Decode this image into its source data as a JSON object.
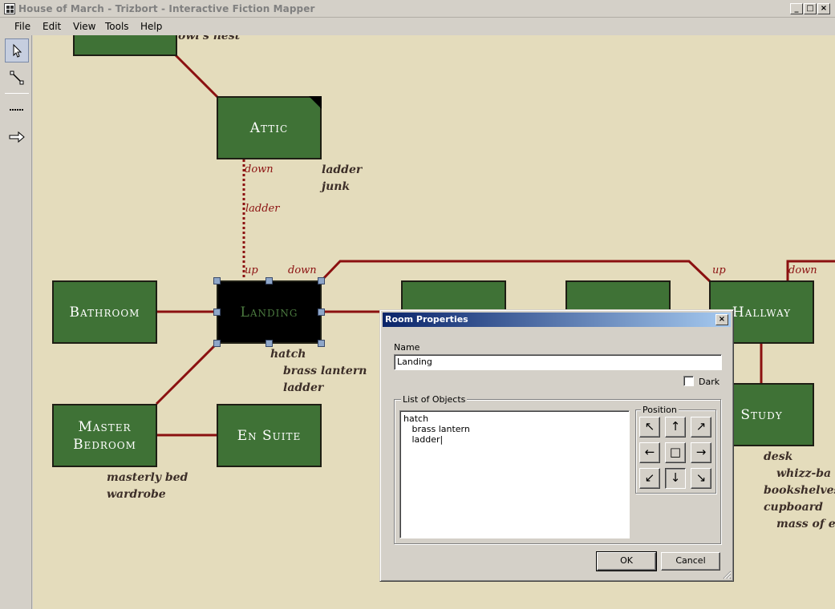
{
  "window": {
    "title": "House of March - Trizbort - Interactive Fiction Mapper",
    "controls": {
      "minimize": "_",
      "maximize": "□",
      "close": "×"
    }
  },
  "menu": [
    "File",
    "Edit",
    "View",
    "Tools",
    "Help"
  ],
  "toolbar": {
    "tools": [
      {
        "name": "select-tool",
        "icon": "pointer-icon",
        "active": true
      },
      {
        "name": "connection-tool",
        "icon": "connect-icon",
        "active": false
      },
      {
        "name": "line-tool",
        "icon": "dashed-line-icon",
        "active": false
      },
      {
        "name": "arrow-tool",
        "icon": "arrow-right-icon",
        "active": false
      }
    ]
  },
  "map": {
    "colors": {
      "canvas": "#e4dcbc",
      "room": "#3f7236",
      "connection": "#8b1010",
      "objects": "#3c2e28"
    },
    "top_partial_text": "owl's nest",
    "rooms": {
      "attic": "Attic",
      "bathroom": "Bathroom",
      "landing": "Landing",
      "master_bedroom_line1": "Master",
      "master_bedroom_line2": "Bedroom",
      "en_suite": "En Suite",
      "hallway": "Hallway",
      "study": "Study"
    },
    "objects": {
      "attic": [
        "ladder",
        "junk"
      ],
      "landing": [
        "hatch",
        "brass lantern",
        "ladder"
      ],
      "master_bedroom": [
        "masterly bed",
        "wardrobe"
      ],
      "study": [
        "desk",
        "whizz-ba",
        "bookshelves",
        "cupboard",
        "mass of el"
      ]
    },
    "connection_labels": {
      "attic_down": "down",
      "attic_ladder": "ladder",
      "landing_up": "up",
      "landing_down": "down",
      "hallway_up": "up",
      "hallway_down": "down"
    }
  },
  "dialog": {
    "title": "Room Properties",
    "close": "×",
    "name_label": "Name",
    "name_value": "Landing",
    "dark_label": "Dark",
    "dark_checked": false,
    "objects_group_label": "List of Objects",
    "objects_text": "hatch\n   brass lantern\n   ladder|",
    "position_group_label": "Position",
    "position_buttons": [
      {
        "name": "position-nw-button",
        "glyph": "↖",
        "pressed": false
      },
      {
        "name": "position-n-button",
        "glyph": "↑",
        "pressed": false
      },
      {
        "name": "position-ne-button",
        "glyph": "↗",
        "pressed": false
      },
      {
        "name": "position-w-button",
        "glyph": "←",
        "pressed": false
      },
      {
        "name": "position-center-button",
        "glyph": "□",
        "pressed": false
      },
      {
        "name": "position-e-button",
        "glyph": "→",
        "pressed": false
      },
      {
        "name": "position-sw-button",
        "glyph": "↙",
        "pressed": false
      },
      {
        "name": "position-s-button",
        "glyph": "↓",
        "pressed": true
      },
      {
        "name": "position-se-button",
        "glyph": "↘",
        "pressed": false
      }
    ],
    "ok_label": "OK",
    "cancel_label": "Cancel"
  }
}
